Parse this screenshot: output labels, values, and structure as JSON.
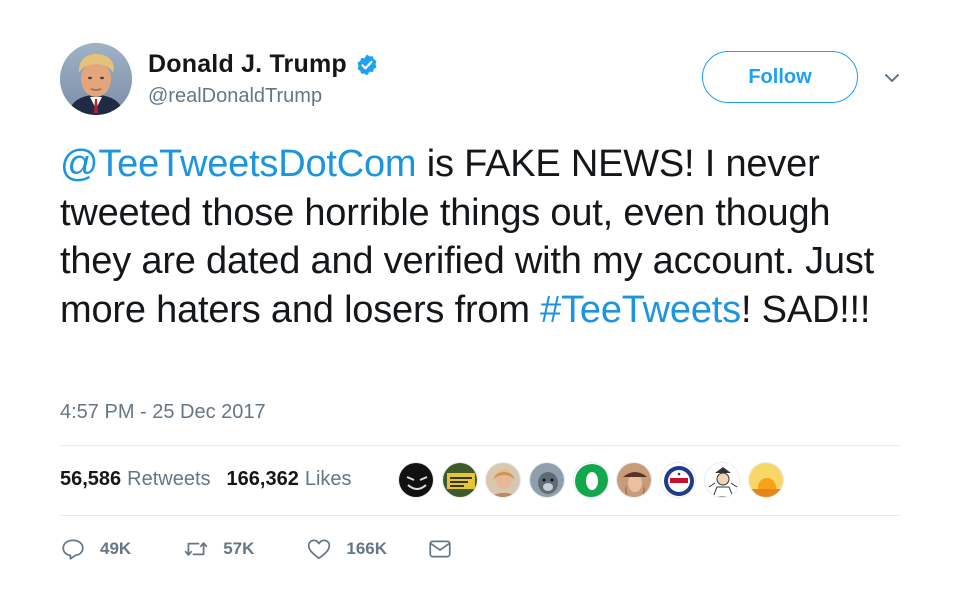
{
  "user": {
    "display_name": "Donald J. Trump",
    "handle": "@realDonaldTrump",
    "verified": true,
    "avatar_icon": "profile-photo"
  },
  "follow_button": {
    "label": "Follow"
  },
  "tweet": {
    "mention": "@TeeTweetsDotCom",
    "text_part1": " is FAKE NEWS! I never tweeted those horrible things out, even though they are dated and verified with my account. Just more haters and losers from ",
    "hashtag": "#TeeTweets",
    "text_part2": "! SAD!!!"
  },
  "timestamp": "4:57 PM - 25 Dec 2017",
  "stats": {
    "retweets_count": "56,586",
    "retweets_label": "Retweets",
    "likes_count": "166,362",
    "likes_label": "Likes"
  },
  "liked_by": [
    {
      "icon": "evil-smiley-avatar"
    },
    {
      "icon": "protest-sign-avatar"
    },
    {
      "icon": "woman-portrait-avatar"
    },
    {
      "icon": "dog-avatar"
    },
    {
      "icon": "green-o-logo-avatar"
    },
    {
      "icon": "woman-hat-avatar"
    },
    {
      "icon": "trump-badge-avatar"
    },
    {
      "icon": "cartoon-person-avatar"
    },
    {
      "icon": "sunset-avatar"
    }
  ],
  "actions": {
    "reply_count": "49K",
    "retweet_count": "57K",
    "like_count": "166K"
  },
  "colors": {
    "link_blue": "#1b95e0",
    "follow_blue": "#1da1f2",
    "muted_gray": "#657786",
    "divider": "#e6ecf0"
  }
}
